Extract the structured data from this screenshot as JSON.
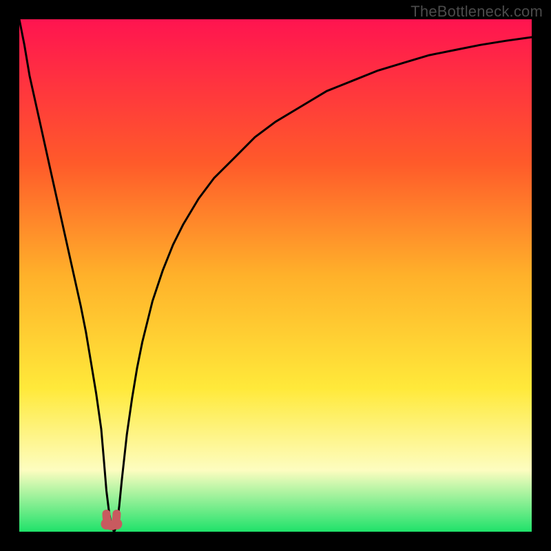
{
  "watermark": "TheBottleneck.com",
  "colors": {
    "frame": "#000000",
    "gradient_top": "#ff1450",
    "gradient_mid1": "#ff5a2a",
    "gradient_mid2": "#ffb12a",
    "gradient_mid3": "#ffe93a",
    "gradient_pale": "#fdfdc0",
    "gradient_bottom": "#1fe26a",
    "curve": "#000000",
    "marker": "#c85a5f"
  },
  "chart_data": {
    "type": "line",
    "title": "",
    "xlabel": "",
    "ylabel": "",
    "xlim": [
      0,
      100
    ],
    "ylim": [
      0,
      100
    ],
    "x": [
      0,
      1,
      2,
      4,
      6,
      8,
      10,
      12,
      13,
      14,
      15,
      16,
      16.5,
      17,
      17.5,
      18,
      18.5,
      19,
      19.5,
      20,
      21,
      22,
      23,
      24,
      26,
      28,
      30,
      32,
      35,
      38,
      42,
      46,
      50,
      55,
      60,
      65,
      70,
      75,
      80,
      85,
      90,
      95,
      100
    ],
    "series": [
      {
        "name": "bottleneck-curve",
        "values": [
          100,
          95,
          89,
          80,
          71,
          62,
          53,
          44,
          39,
          33,
          27,
          20,
          14,
          8,
          4,
          1,
          0,
          1,
          5,
          10,
          19,
          26,
          32,
          37,
          45,
          51,
          56,
          60,
          65,
          69,
          73,
          77,
          80,
          83,
          86,
          88,
          90,
          91.5,
          93,
          94,
          95,
          95.8,
          96.5
        ]
      }
    ],
    "markers": [
      {
        "name": "optimal-point-left",
        "x": 17.0,
        "y": 1.5
      },
      {
        "name": "optimal-point-right",
        "x": 19.0,
        "y": 1.5
      }
    ],
    "annotations": []
  }
}
